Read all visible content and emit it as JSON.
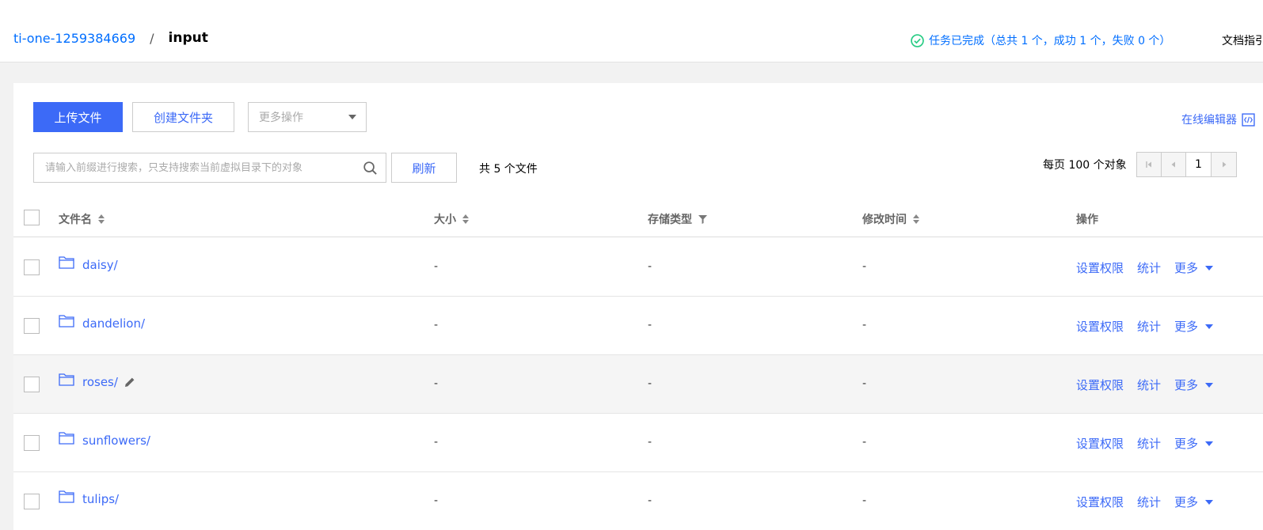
{
  "breadcrumb": {
    "bucket": "ti-one-1259384669",
    "separator": "/",
    "current": "input"
  },
  "task_status": "任务已完成（总共 1 个，成功 1 个，失败 0 个）",
  "doc_link": "文档指引",
  "toolbar": {
    "upload_label": "上传文件",
    "create_folder_label": "创建文件夹",
    "more_actions_label": "更多操作",
    "online_editor_label": "在线编辑器"
  },
  "search": {
    "placeholder": "请输入前缀进行搜索，只支持搜索当前虚拟目录下的对象",
    "value": ""
  },
  "refresh_label": "刷新",
  "total_files": "共 5 个文件",
  "pagination": {
    "per_page": "每页 100 个对象",
    "current_page": "1"
  },
  "table": {
    "headers": {
      "name": "文件名",
      "size": "大小",
      "storage": "存储类型",
      "modified": "修改时间",
      "actions": "操作"
    },
    "rows": [
      {
        "name": "daisy/",
        "size": "-",
        "storage": "-",
        "modified": "-"
      },
      {
        "name": "dandelion/",
        "size": "-",
        "storage": "-",
        "modified": "-"
      },
      {
        "name": "roses/",
        "size": "-",
        "storage": "-",
        "modified": "-"
      },
      {
        "name": "sunflowers/",
        "size": "-",
        "storage": "-",
        "modified": "-"
      },
      {
        "name": "tulips/",
        "size": "-",
        "storage": "-",
        "modified": "-"
      }
    ],
    "row_actions": {
      "permissions": "设置权限",
      "stats": "统计",
      "more": "更多"
    }
  },
  "colors": {
    "primary": "#3c6af7",
    "link": "#006eff",
    "success": "#29cc85"
  }
}
